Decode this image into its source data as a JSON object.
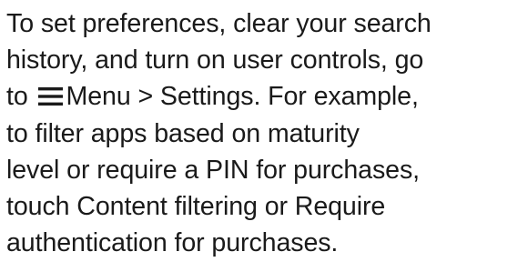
{
  "paragraph": {
    "line1": "To set preferences, clear your search",
    "line2": "history, and turn on user controls, go",
    "line3_before": "to",
    "menu_icon": "hamburger-menu-icon",
    "line3_after": "Menu > Settings. For example,",
    "line4": "to filter apps based on maturity",
    "line5": "level or require a PIN for purchases,",
    "line6": "touch Content filtering or Require",
    "line7": "authentication for purchases."
  },
  "colors": {
    "text": "#1a1a1a",
    "background": "#ffffff"
  }
}
